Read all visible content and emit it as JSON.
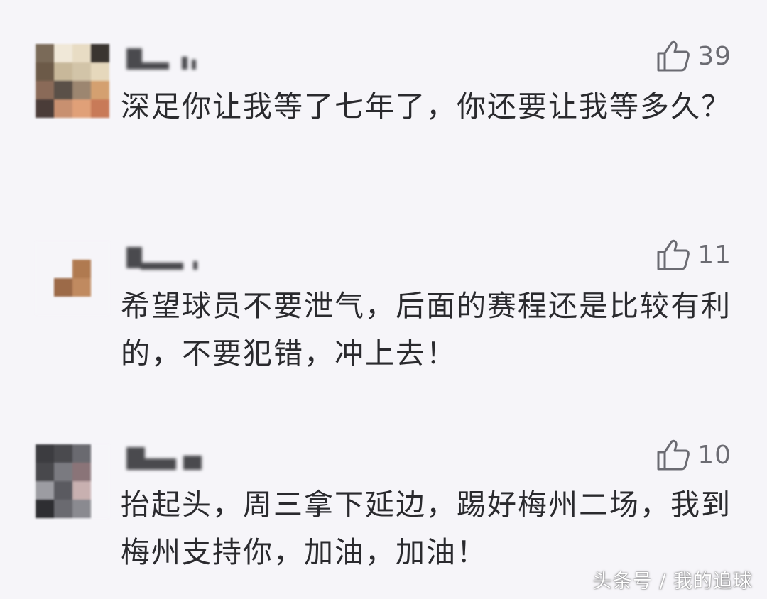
{
  "comments": [
    {
      "likes": "39",
      "text": "深足你让我等了七年了，你还要让我等多久？",
      "avatar_colors": [
        "#7a6a58",
        "#f0e8d8",
        "#e8dcc4",
        "#3a3530",
        "#6c5a48",
        "#c8b89a",
        "#d2c4a8",
        "#e6d8bc",
        "#8a6a58",
        "#5a5048",
        "#9c8670",
        "#d4a070",
        "#4a3c38",
        "#c89070",
        "#e0a078",
        "#c87a58"
      ]
    },
    {
      "likes": "11",
      "text": "希望球员不要泄气，后面的赛程还是比较有利的，不要犯错，冲上去！",
      "avatar_colors": [
        "#f6f5f9",
        "#f6f5f9",
        "#f6f5f9",
        "#f6f5f9",
        "#f6f5f9",
        "#f6f5f9",
        "#b07a50",
        "#f6f5f9",
        "#f6f5f9",
        "#9c6a48",
        "#c08a60",
        "#f6f5f9",
        "#f6f5f9",
        "#f6f5f9",
        "#f6f5f9",
        "#f6f5f9"
      ]
    },
    {
      "likes": "10",
      "text": "抬起头，周三拿下延边，踢好梅州二场，我到梅州支持你，加油，加油！",
      "avatar_colors": [
        "#3c3c40",
        "#4a4a4e",
        "#6a6a70",
        "#f6f5f9",
        "#48484c",
        "#7a7a80",
        "#8a7478",
        "#f6f5f9",
        "#9c9ca2",
        "#5a5a60",
        "#c8b0b0",
        "#f6f5f9",
        "#2e2e32",
        "#6a6a70",
        "#8a8a90",
        "#f6f5f9"
      ]
    }
  ],
  "watermark": "头条号 / 我的追球",
  "colors": {
    "background": "#f6f5f9",
    "text": "#2a2a2e",
    "like": "#6b6b72"
  }
}
